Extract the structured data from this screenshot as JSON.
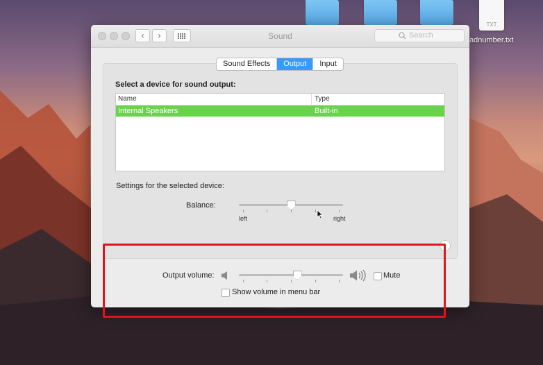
{
  "desktop": {
    "file_type_badge": "TXT",
    "file_label": "adnumber.txt"
  },
  "window": {
    "title": "Sound",
    "search": {
      "placeholder": "Search"
    }
  },
  "tabs": [
    {
      "label": "Sound Effects",
      "active": false
    },
    {
      "label": "Output",
      "active": true
    },
    {
      "label": "Input",
      "active": false
    }
  ],
  "output": {
    "section_title": "Select a device for sound output:",
    "columns": [
      "Name",
      "Type"
    ],
    "devices": [
      {
        "name": "Internal Speakers",
        "type": "Built-in",
        "selected": true
      }
    ],
    "settings_label": "Settings for the selected device:",
    "balance": {
      "label": "Balance:",
      "left_label": "left",
      "right_label": "right",
      "value": 0.5
    }
  },
  "volume": {
    "label": "Output volume:",
    "value": 0.56,
    "mute_label": "Mute",
    "mute_checked": false,
    "show_in_menu_label": "Show volume in menu bar",
    "show_in_menu_checked": false
  },
  "colors": {
    "accent": "#3b99fc",
    "selection_row": "#69d34b",
    "highlight_box": "#e0141c"
  }
}
